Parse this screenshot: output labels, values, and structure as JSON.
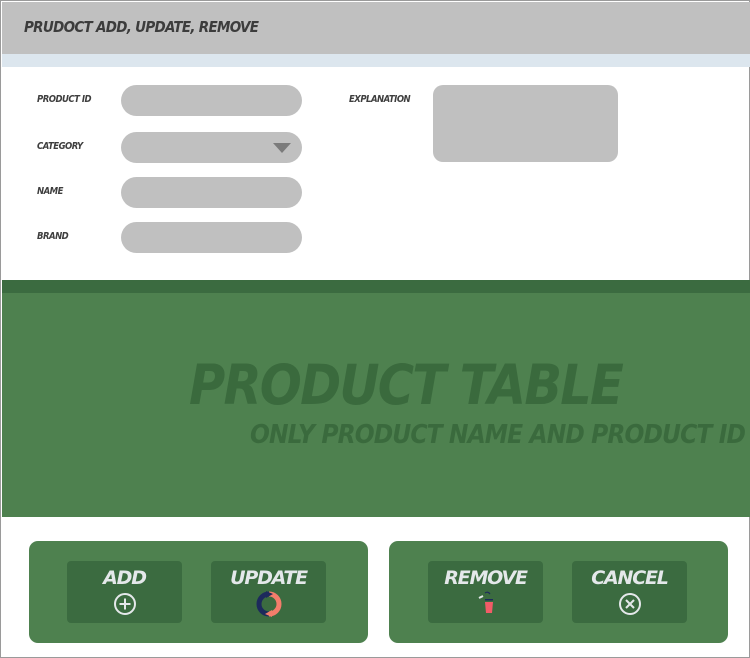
{
  "window": {
    "title": "PRUDOCT ADD, UPDATE, REMOVE"
  },
  "form": {
    "product_id_label": "PRODUCT ID",
    "category_label": "CATEGORY",
    "name_label": "NAME",
    "brand_label": "BRAND",
    "explanation_label": "EXPLANATION",
    "product_id_value": "",
    "category_value": "",
    "name_value": "",
    "brand_value": "",
    "explanation_value": ""
  },
  "table": {
    "title": "PRODUCT TABLE",
    "subtitle": "ONLY PRODUCT NAME AND PRODUCT ID"
  },
  "actions": {
    "add_label": "ADD",
    "update_label": "UPDATE",
    "remove_label": "REMOVE",
    "cancel_label": "CANCEL"
  },
  "icons": {
    "add": "plus-circle-icon",
    "update": "refresh-icon",
    "remove": "trash-icon",
    "cancel": "x-circle-icon"
  },
  "colors": {
    "title_bar": "#c0c0c0",
    "table_background": "#4e814f",
    "button_background": "#3b6b40",
    "update_icon_dark": "#1d2a5c",
    "update_icon_accent": "#f47d6b",
    "trash_icon": "#f25c67"
  }
}
